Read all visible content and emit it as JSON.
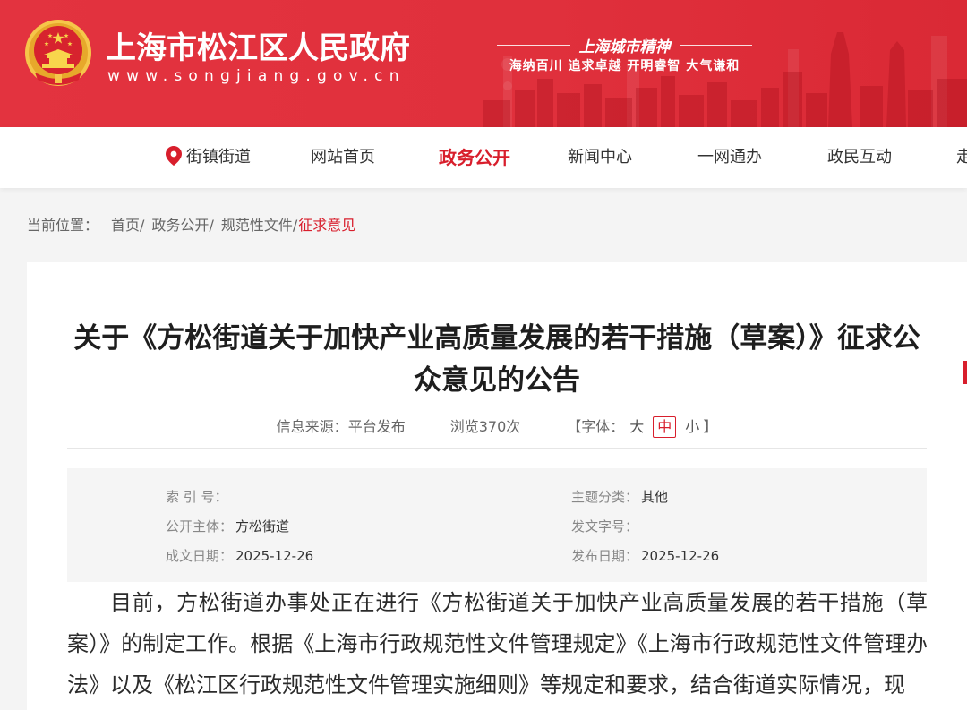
{
  "header": {
    "site_title": "上海市松江区人民政府",
    "site_url": "www.songjiang.gov.cn",
    "emblem_icon": "national-emblem-icon",
    "spirit_title": "上海城市精神",
    "spirit_slogan": "海纳百川 追求卓越 开明睿智 大气谦和",
    "background_color": "#e1313d"
  },
  "nav": {
    "items": [
      {
        "label": "街镇街道",
        "icon": "location-pin-icon"
      },
      {
        "label": "网站首页"
      },
      {
        "label": "政务公开",
        "active": true
      },
      {
        "label": "新闻中心"
      },
      {
        "label": "一网通办"
      },
      {
        "label": "政民互动"
      },
      {
        "label": "走"
      }
    ],
    "active_color": "#d81e2c"
  },
  "breadcrumb": {
    "prefix": "当前位置：",
    "separator": "/",
    "items": [
      {
        "label": "首页"
      },
      {
        "label": "政务公开"
      },
      {
        "label": "规范性文件"
      },
      {
        "label": "征求意见",
        "current": true
      }
    ]
  },
  "article": {
    "title": "关于《方松街道关于加快产业高质量发展的若干措施（草案）》征求公众意见的公告",
    "meta": {
      "source_label": "信息来源：",
      "source_value": "平台发布",
      "views": "浏览370次",
      "font_size_open": "【字体：",
      "font_size_options": [
        {
          "label": "大"
        },
        {
          "label": "中",
          "selected": true
        },
        {
          "label": "小"
        }
      ],
      "font_size_close": "】"
    },
    "info": [
      {
        "label": "索 引 号：",
        "value": ""
      },
      {
        "label": "主题分类：",
        "value": "其他"
      },
      {
        "label": "公开主体：",
        "value": "方松街道"
      },
      {
        "label": "发文字号：",
        "value": ""
      },
      {
        "label": "成文日期：",
        "value": "2025-12-26"
      },
      {
        "label": "发布日期：",
        "value": "2025-12-26"
      }
    ],
    "body": [
      "目前，方松街道办事处正在进行《方松街道关于加快产业高质量发展的若干措施（草案）》的制定工作。根据《上海市行政规范性文件管理规定》《上海市行政规范性文件管理办法》以及《松江区行政规范性文件管理实施细则》等规定和要求，结合街道实际情况，现"
    ]
  }
}
